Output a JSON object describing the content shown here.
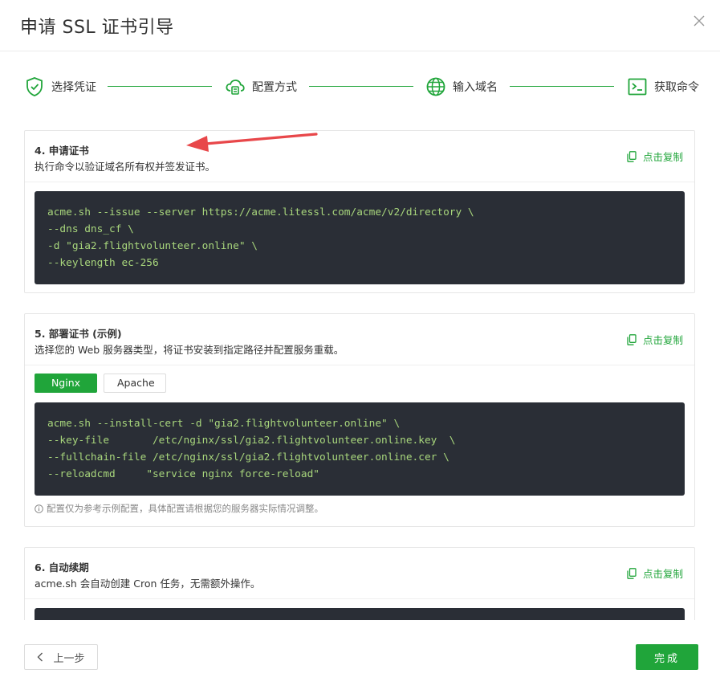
{
  "dialog": {
    "title": "申请 SSL 证书引导"
  },
  "steps": [
    {
      "label": "选择凭证",
      "icon": "shield-check-icon"
    },
    {
      "label": "配置方式",
      "icon": "cloud-config-icon"
    },
    {
      "label": "输入域名",
      "icon": "globe-icon"
    },
    {
      "label": "获取命令",
      "icon": "terminal-icon"
    }
  ],
  "sections": {
    "issue": {
      "title": "4. 申请证书",
      "desc": "执行命令以验证域名所有权并签发证书。",
      "copy_label": "点击复制",
      "code": [
        "acme.sh --issue --server https://acme.litessl.com/acme/v2/directory \\",
        "--dns dns_cf \\",
        "-d \"gia2.flightvolunteer.online\" \\",
        "--keylength ec-256"
      ]
    },
    "deploy": {
      "title": "5. 部署证书 (示例)",
      "desc": "选择您的 Web 服务器类型，将证书安装到指定路径并配置服务重载。",
      "copy_label": "点击复制",
      "tabs": [
        "Nginx",
        "Apache"
      ],
      "active_tab": "Nginx",
      "code": [
        "acme.sh --install-cert -d \"gia2.flightvolunteer.online\" \\",
        "--key-file       /etc/nginx/ssl/gia2.flightvolunteer.online.key  \\",
        "--fullchain-file /etc/nginx/ssl/gia2.flightvolunteer.online.cer \\",
        "--reloadcmd     \"service nginx force-reload\""
      ],
      "note": "配置仅为参考示例配置，具体配置请根据您的服务器实际情况调整。"
    },
    "renew": {
      "title": "6. 自动续期",
      "desc": "acme.sh 会自动创建 Cron 任务，无需额外操作。",
      "copy_label": "点击复制"
    }
  },
  "footer": {
    "prev_label": "上一步",
    "done_label": "完成"
  },
  "colors": {
    "accent": "#20a53a",
    "code_bg": "#2a2e36",
    "code_text": "#a8d67c",
    "annotation": "#e8474a"
  }
}
